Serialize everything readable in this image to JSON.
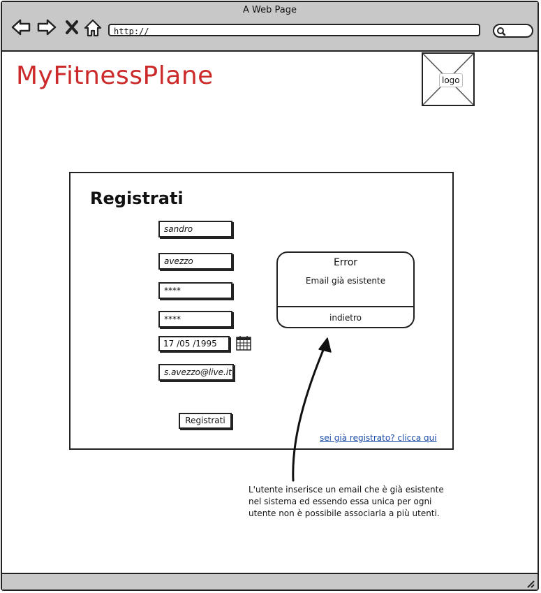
{
  "window": {
    "title": "A Web Page"
  },
  "browser": {
    "url": "http://",
    "icons": [
      "back-arrow-icon",
      "forward-arrow-icon",
      "close-x-icon",
      "home-icon",
      "search-icon"
    ]
  },
  "header": {
    "brand": "MyFitnessPlane",
    "logo_label": "logo"
  },
  "form": {
    "title": "Registrati",
    "fields": [
      {
        "name": "first-name-field",
        "value": "sandro"
      },
      {
        "name": "last-name-field",
        "value": "avezzo"
      },
      {
        "name": "password-field",
        "value": "****"
      },
      {
        "name": "confirm-password-field",
        "value": "****"
      },
      {
        "name": "email-field",
        "value": "s.avezzo@live.it"
      }
    ],
    "date": "17  /05  /1995",
    "submit_label": "Registrati",
    "login_link": "sei già registrato? clicca qui"
  },
  "error_dialog": {
    "title": "Error",
    "message": "Email già esistente",
    "back_label": "indietro"
  },
  "annotation": {
    "text": "L'utente inserisce un email che è già esistente nel sistema ed essendo essa unica per ogni utente non è possibile associarla a più utenti."
  },
  "colors": {
    "brand": "#cc2a2a",
    "link": "#1a4aa8",
    "chrome": "#c8c8c8"
  }
}
